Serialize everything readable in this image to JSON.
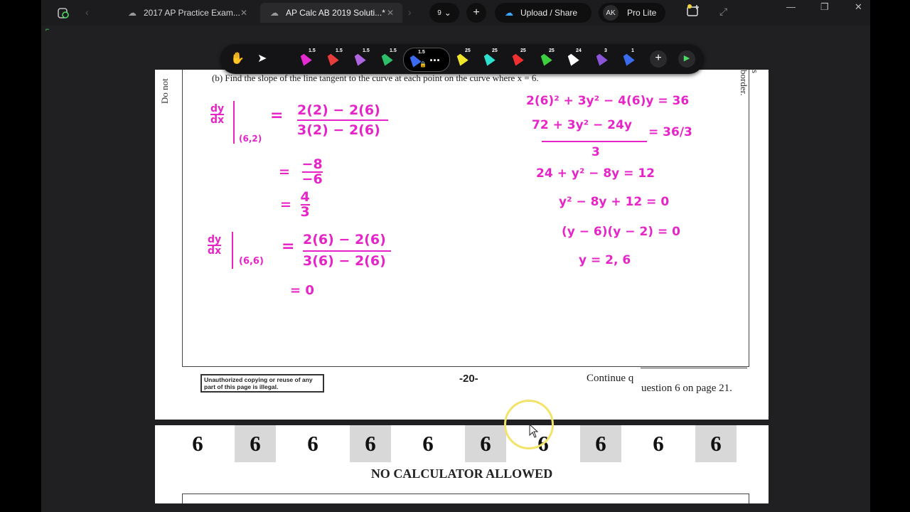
{
  "tabs": [
    {
      "label": "2017 AP Practice Exam..."
    },
    {
      "label": "AP Calc AB 2019 Soluti...*"
    }
  ],
  "tab_count": "9",
  "upload_label": "Upload / Share",
  "user": {
    "initials": "AK",
    "plan": "Pro Lite"
  },
  "toolbar": {
    "sizes": [
      "1.5",
      "1.5",
      "1.5",
      "1.5",
      "1.5",
      "25",
      "25",
      "25",
      "25",
      "24",
      "3",
      "1"
    ],
    "colors": [
      "#e42bd1",
      "#e83b3b",
      "#b066e0",
      "#2cc06a",
      "#3b6cf0",
      "#f2e62a",
      "#2ee0d0",
      "#f03030",
      "#3cd040",
      "#ffffff",
      "#8a55d8",
      "#3b6cf0"
    ],
    "more_label": "..."
  },
  "document": {
    "question": "(b)  Find the slope of the line tangent to the curve at each point on the curve where x = 6.",
    "margin_left": "Do not",
    "margin_right": "s border.",
    "footer_notice": "Unauthorized copying or reuse of any part of this page is illegal.",
    "page_number": "-20-",
    "continue_text": "Continue q",
    "continue_rest": "uestion 6 on page 21.",
    "sixes": [
      "6",
      "6",
      "6",
      "6",
      "6",
      "6",
      "6",
      "6",
      "6",
      "6"
    ],
    "no_calc": "NO CALCULATOR ALLOWED"
  },
  "handwriting": {
    "dydx": "dy\ndx",
    "point1": "(6,2)",
    "frac1_num": "2(2) − 2(6)",
    "frac1_den": "3(2) − 2(6)",
    "step2": "= −8/−6",
    "step3": "= 4/3",
    "point2": "(6,6)",
    "frac2_num": "2(6) − 2(6)",
    "frac2_den": "3(6) − 2(6)",
    "step4": "= 0",
    "r1": "2(6)² + 3y² − 4(6)y = 36",
    "r2_num": "72 + 3y² − 24y",
    "r2_den": "3",
    "r2_rhs": "= 36/3",
    "r3": "24 + y² − 8y = 12",
    "r4": "y² − 8y + 12 = 0",
    "r5": "(y − 6)(y − 2) = 0",
    "r6": "y = 2, 6"
  }
}
